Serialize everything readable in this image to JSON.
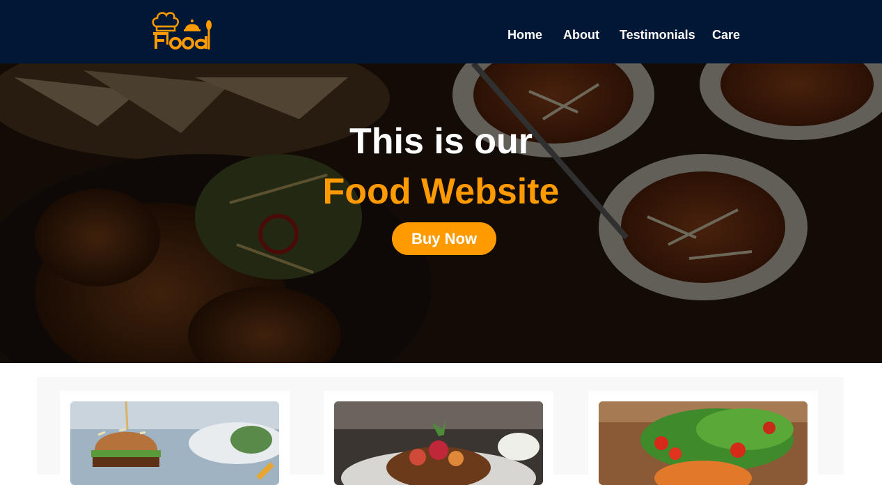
{
  "brand": {
    "logo_text": "Food",
    "logo_icon": "chef-hat-icon"
  },
  "nav": {
    "items": [
      {
        "label": "Home"
      },
      {
        "label": "About"
      },
      {
        "label": "Testimonials"
      },
      {
        "label": "Care"
      }
    ]
  },
  "hero": {
    "line1": "This is our",
    "line2": "Food Website",
    "button_label": "Buy Now"
  },
  "cards": [
    {
      "image": "burger-photo"
    },
    {
      "image": "dessert-photo"
    },
    {
      "image": "salad-photo"
    }
  ],
  "colors": {
    "navbar": "#001835",
    "accent": "#ff9a00",
    "section_bg": "#f8f8f8"
  }
}
